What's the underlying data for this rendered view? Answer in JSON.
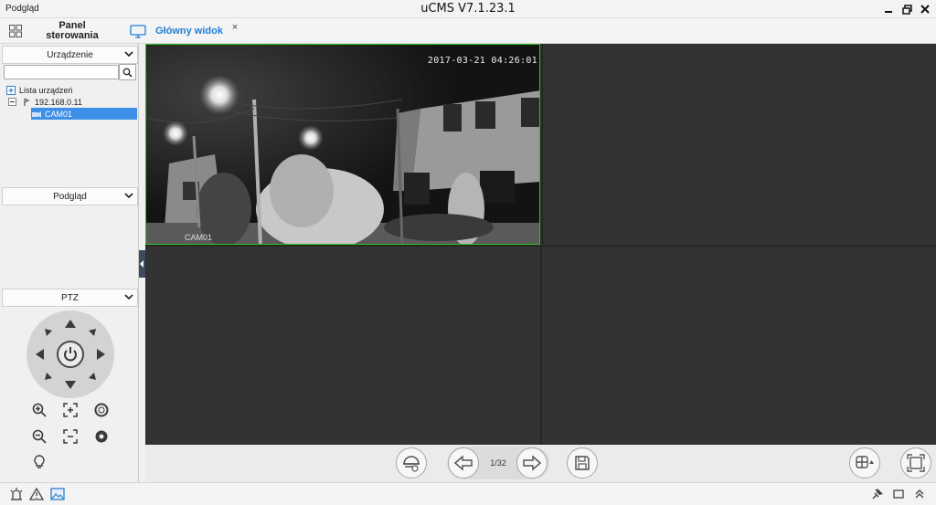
{
  "window": {
    "left_title": "Podgląd",
    "title": "uCMS V7.1.23.1"
  },
  "tabs": {
    "control_panel_label": "Panel sterowania",
    "main_view_label": "Główny widok",
    "close_symbol": "×"
  },
  "sidebar": {
    "device_section": {
      "title": "Urządzenie",
      "search_placeholder": "",
      "tree": [
        {
          "label": "Lista urządzeń",
          "icon": "device-list-icon"
        },
        {
          "label": "192.168.0.11",
          "icon": "dvr-icon"
        },
        {
          "label": "CAM01",
          "icon": "camera-icon",
          "selected": true
        }
      ]
    },
    "preview_section": {
      "title": "Podgląd"
    },
    "ptz_section": {
      "title": "PTZ"
    }
  },
  "video": {
    "cell1": {
      "timestamp": "2017-03-21 04:26:01",
      "camera_name": "CAM01",
      "active": true
    },
    "active_border_color": "#27c21f"
  },
  "toolbar": {
    "page_indicator": "1/32"
  },
  "colors": {
    "accent": "#1e7fd6",
    "selection": "#3d8ee6"
  }
}
